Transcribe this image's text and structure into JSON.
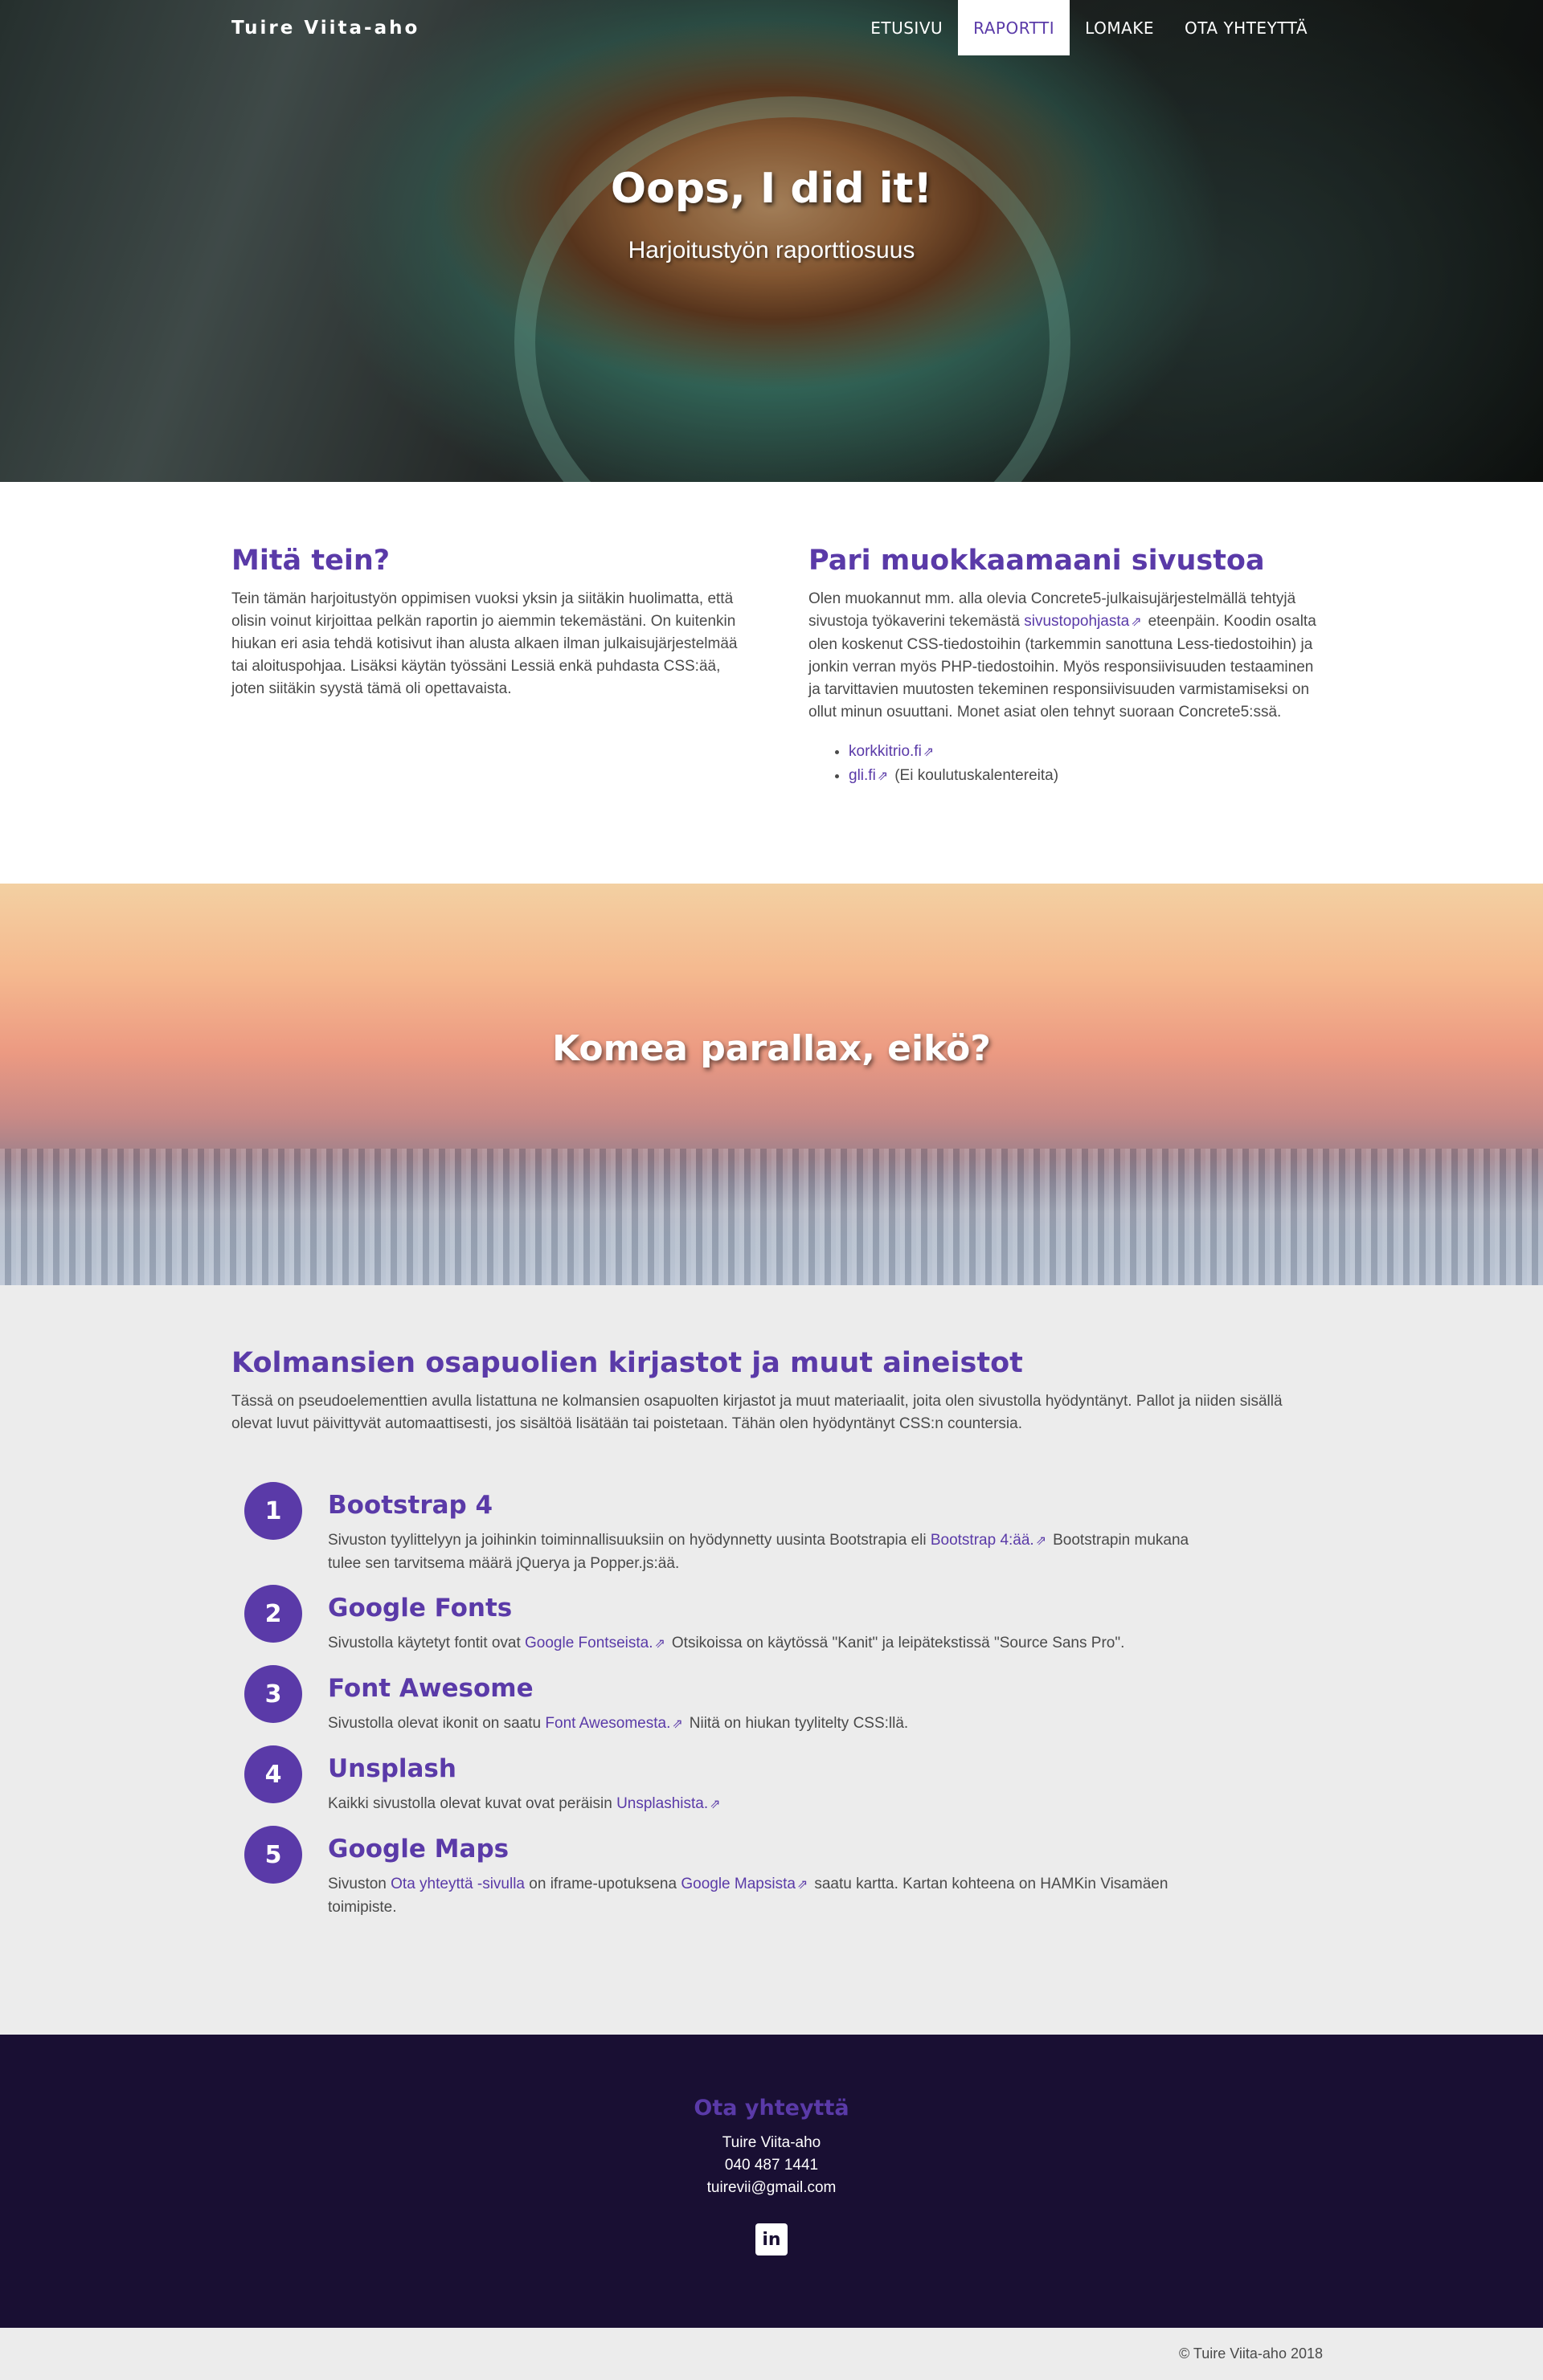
{
  "nav": {
    "brand": "Tuire Viita-aho",
    "links": [
      "ETUSIVU",
      "RAPORTTI",
      "LOMAKE",
      "OTA YHTEYTTÄ"
    ]
  },
  "hero": {
    "title": "Oops, I did it!",
    "subtitle": "Harjoitustyön raporttiosuus"
  },
  "left": {
    "title": "Mitä tein?",
    "body": "Tein tämän harjoitustyön oppimisen vuoksi yksin ja siitäkin huolimatta, että olisin voinut kirjoittaa pelkän raportin jo aiemmin tekemästäni. On kuitenkin hiukan eri asia tehdä kotisivut ihan alusta alkaen ilman julkaisujärjestelmää tai aloituspohjaa. Lisäksi käytän työssäni Lessiä enkä puhdasta CSS:ää, joten siitäkin syystä tämä oli opettavaista."
  },
  "right": {
    "title": "Pari muokkaamaani sivustoa",
    "body_before": "Olen muokannut mm. alla olevia Concrete5-julkaisujärjestelmällä tehtyjä sivustoja työkaverini tekemästä ",
    "body_link": "sivustopohjasta",
    "body_after": "eteenpäin. Koodin osalta olen koskenut CSS-tiedostoihin (tarkemmin sanottuna Less-tiedostoihin) ja jonkin verran myös PHP-tiedostoihin. Myös responsiivisuuden testaaminen ja tarvittavien muutosten tekeminen responsiivisuuden varmistamiseksi on ollut minun osuuttani. Monet asiat olen tehnyt suoraan Concrete5:ssä.",
    "items": [
      {
        "link": "korkkitrio.fi",
        "note": ""
      },
      {
        "link": "gli.fi",
        "note": "(Ei koulutuskalentereita)"
      }
    ]
  },
  "parallax": {
    "title": "Komea parallax, eikö?"
  },
  "resources": {
    "title": "Kolmansien osapuolien kirjastot ja muut aineistot",
    "lead": "Tässä on pseudoelementtien avulla listattuna ne kolmansien osapuolten kirjastot ja muut materiaalit, joita olen sivustolla hyödyntänyt. Pallot ja niiden sisällä olevat luvut päivittyvät automaattisesti, jos sisältöä lisätään tai poistetaan. Tähän olen hyödyntänyt CSS:n countersia.",
    "steps": [
      {
        "num": "1",
        "title": "Bootstrap 4",
        "before": "Sivuston tyylittelyyn ja joihinkin toiminnallisuuksiin on hyödynnetty uusinta Bootstrapia eli ",
        "link": "Bootstrap 4:ää.",
        "after": "Bootstrapin mukana tulee sen tarvitsema määrä jQuerya ja Popper.js:ää."
      },
      {
        "num": "2",
        "title": "Google Fonts",
        "before": "Sivustolla käytetyt fontit ovat ",
        "link": "Google Fontseista.",
        "after": "Otsikoissa on käytössä \"Kanit\" ja leipätekstissä \"Source Sans Pro\"."
      },
      {
        "num": "3",
        "title": "Font Awesome",
        "before": "Sivustolla olevat ikonit on saatu ",
        "link": "Font Awesomesta.",
        "after": "Niitä on hiukan tyylitelty CSS:llä."
      },
      {
        "num": "4",
        "title": "Unsplash",
        "before": "Kaikki sivustolla olevat kuvat ovat peräisin ",
        "link": "Unsplashista.",
        "after": ""
      },
      {
        "num": "5",
        "title": "Google Maps",
        "before": "Sivuston ",
        "link": "Ota yhteyttä -sivulla",
        "middle": "on iframe-upotuksena ",
        "link2": "Google Mapsista",
        "after": "saatu kartta. Kartan kohteena on HAMKin Visamäen toimipiste."
      }
    ]
  },
  "footer": {
    "title": "Ota yhteyttä",
    "name": "Tuire Viita-aho",
    "phone": "040 487 1441",
    "email": "tuirevii@gmail.com",
    "social_icon": "linkedin-icon",
    "social_glyph": "in"
  },
  "copyright": "© Tuire Viita-aho 2018",
  "ext_glyph": "⇗",
  "colors": {
    "accent": "#5a3aa8",
    "footer_bg": "#190f33",
    "section_bg": "#ececec"
  }
}
